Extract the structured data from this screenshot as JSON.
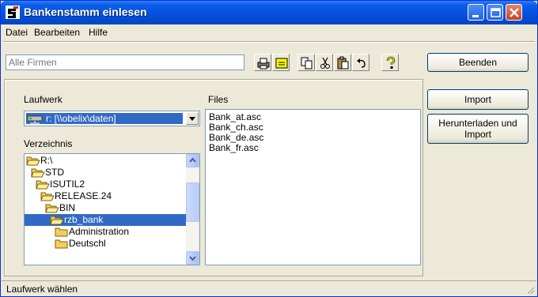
{
  "window": {
    "title": "Bankenstamm einlesen"
  },
  "menu": [
    {
      "label": "Datei"
    },
    {
      "label": "Bearbeiten"
    },
    {
      "label": "Hilfe"
    }
  ],
  "toolbar": {
    "filter_placeholder": "Alle Firmen",
    "end_button": "Beenden"
  },
  "left_panel": {
    "drive_label": "Laufwerk",
    "drive_value": "r: [\\\\obelix\\daten]",
    "dir_label": "Verzeichnis",
    "dirs": [
      {
        "name": "R:\\"
      },
      {
        "name": "STD"
      },
      {
        "name": "ISUTIL2"
      },
      {
        "name": "RELEASE.24"
      },
      {
        "name": "BIN"
      },
      {
        "name": "rzb_bank"
      },
      {
        "name": "Administration"
      },
      {
        "name": "Deutschl"
      }
    ]
  },
  "files_panel": {
    "label": "Files",
    "files": [
      "Bank_at.asc",
      "Bank_ch.asc",
      "Bank_de.asc",
      "Bank_fr.asc"
    ]
  },
  "actions": {
    "import": "Import",
    "download_import_line1": "Herunterladen und",
    "download_import_line2": "Import"
  },
  "status": {
    "text": "Laufwerk wählen"
  },
  "colors": {
    "titlebar": "#0550dc",
    "selection": "#316ac5",
    "face": "#ece9d8"
  }
}
